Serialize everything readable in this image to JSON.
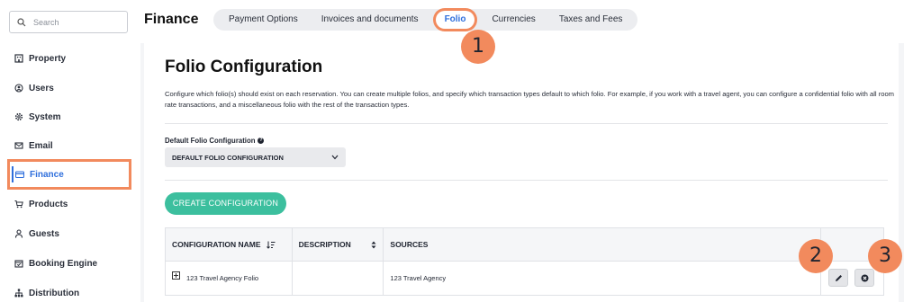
{
  "sidebar": {
    "search_placeholder": "Search",
    "items": [
      {
        "label": "Property",
        "icon": "building-icon"
      },
      {
        "label": "Users",
        "icon": "user-circle-icon"
      },
      {
        "label": "System",
        "icon": "gear-icon"
      },
      {
        "label": "Email",
        "icon": "envelope-icon"
      },
      {
        "label": "Finance",
        "icon": "credit-card-icon",
        "active": true
      },
      {
        "label": "Products",
        "icon": "cart-icon"
      },
      {
        "label": "Guests",
        "icon": "person-icon"
      },
      {
        "label": "Booking Engine",
        "icon": "calendar-check-icon"
      },
      {
        "label": "Distribution",
        "icon": "sitemap-icon"
      }
    ]
  },
  "header": {
    "title": "Finance",
    "tabs": [
      {
        "label": "Payment Options"
      },
      {
        "label": "Invoices and documents"
      },
      {
        "label": "Folio",
        "active": true
      },
      {
        "label": "Currencies"
      },
      {
        "label": "Taxes and Fees"
      }
    ]
  },
  "main": {
    "title": "Folio Configuration",
    "description": "Configure which folio(s) should exist on each reservation. You can create multiple folios, and specify which transaction types default to which folio. For example, if you work with a travel agent, you can configure a confidential folio with all room rate transactions, and a miscellaneous folio with the rest of the transaction types.",
    "default_label": "Default Folio Configuration",
    "default_value": "DEFAULT FOLIO CONFIGURATION",
    "create_button": "CREATE CONFIGURATION",
    "table": {
      "columns": [
        "CONFIGURATION NAME",
        "DESCRIPTION",
        "SOURCES",
        ""
      ],
      "rows": [
        {
          "name": "123 Travel Agency Folio",
          "description": "",
          "sources": "123 Travel Agency"
        }
      ]
    }
  },
  "callouts": [
    "1",
    "2",
    "3"
  ],
  "colors": {
    "accent": "#2f6fdc",
    "highlight": "#f28a5d",
    "create_button": "#3cbf9e"
  }
}
